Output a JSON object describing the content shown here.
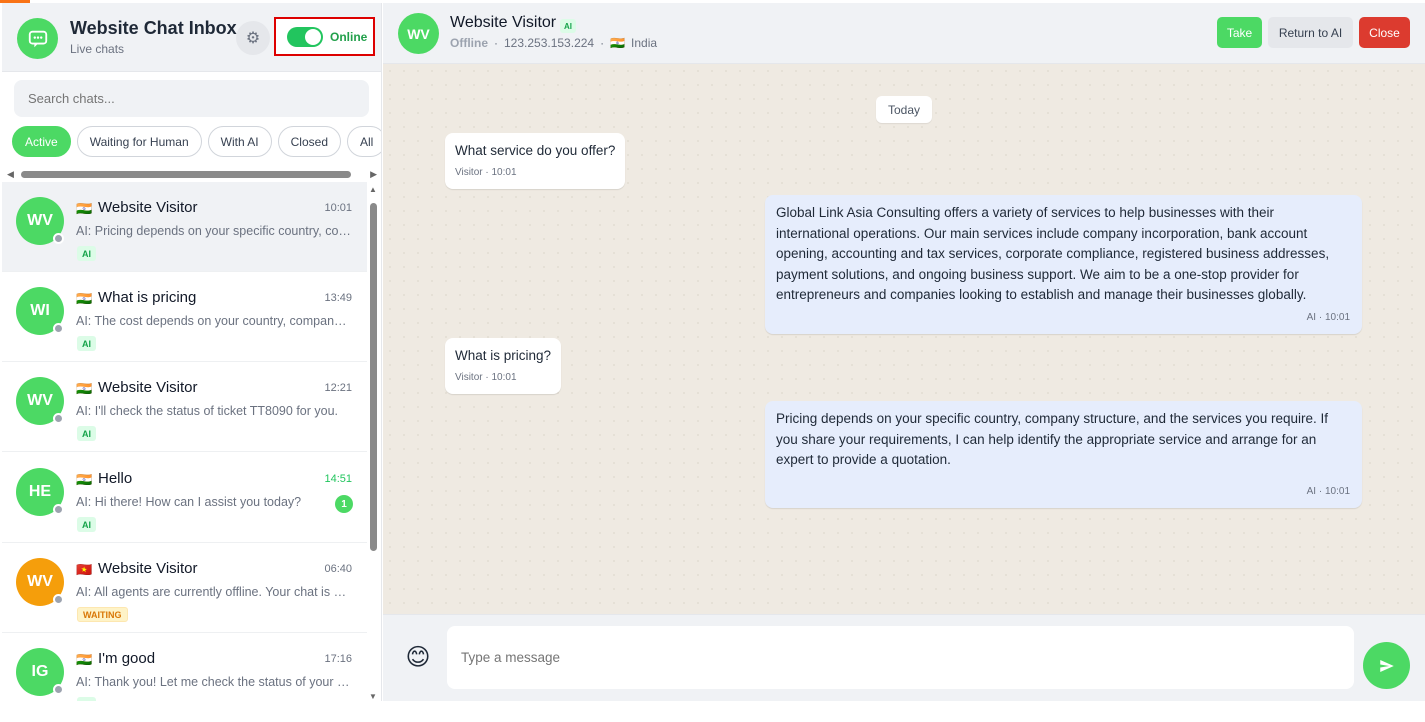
{
  "sidebar": {
    "title": "Website Chat Inbox",
    "subtitle": "Live chats",
    "online_label": "Online",
    "search_placeholder": "Search chats...",
    "filters": [
      "Active",
      "Waiting for Human",
      "With AI",
      "Closed",
      "All"
    ],
    "chats": [
      {
        "initials": "WV",
        "flag": "🇮🇳",
        "name": "Website Visitor",
        "time": "10:01",
        "preview": "AI: Pricing depends on your specific country, company structure, and the services you require.",
        "badge": "AI"
      },
      {
        "initials": "WI",
        "flag": "🇮🇳",
        "name": "What is pricing",
        "time": "13:49",
        "preview": "AI: The cost depends on your country, company structure and services.",
        "badge": "AI"
      },
      {
        "initials": "WV",
        "flag": "🇮🇳",
        "name": "Website Visitor",
        "time": "12:21",
        "preview": "AI: I'll check the status of ticket TT8090 for you.",
        "badge": "AI"
      },
      {
        "initials": "HE",
        "flag": "🇮🇳",
        "name": "Hello",
        "time": "14:51",
        "preview": "AI: Hi there! How can I assist you today?",
        "badge": "AI",
        "unread": "1"
      },
      {
        "initials": "WV",
        "flag": "🇻🇳",
        "name": "Website Visitor",
        "time": "06:40",
        "preview": "AI: All agents are currently offline. Your chat is queued.",
        "badge": "WAITING"
      },
      {
        "initials": "IG",
        "flag": "🇮🇳",
        "name": "I'm good",
        "time": "17:16",
        "preview": "AI: Thank you! Let me check the status of your request.",
        "badge": "AI"
      }
    ]
  },
  "conversation": {
    "initials": "WV",
    "name": "Website Visitor",
    "ai_badge": "AI",
    "status": "Offline",
    "ip": "123.253.153.224",
    "flag": "🇮🇳",
    "country": "India",
    "take_label": "Take",
    "return_label": "Return to AI",
    "close_label": "Close",
    "date_divider": "Today",
    "messages": [
      {
        "text": "What service do you offer?",
        "meta": "Visitor · 10:01"
      },
      {
        "text": "Global Link Asia Consulting offers a variety of services to help businesses with their international operations. Our main services include company incorporation, bank account opening, accounting and tax services, corporate compliance, registered business addresses, payment solutions, and ongoing business support. We aim to be a one-stop provider for entrepreneurs and companies looking to establish and manage their businesses globally.",
        "meta": "AI · 10:01"
      },
      {
        "text": "What is pricing?",
        "meta": "Visitor · 10:01"
      },
      {
        "text": "Pricing depends on your specific country, company structure, and the services you require. If you share your requirements, I can help identify the appropriate service and arrange for an expert to provide a quotation.",
        "meta": "AI · 10:01"
      }
    ],
    "input_placeholder": "Type a message"
  },
  "icons": {
    "app": "chat-bubble-icon",
    "settings": "gear-icon",
    "emoji": "smiley-icon",
    "send": "send-arrow-icon"
  },
  "colors": {
    "accent_green": "#4cd964",
    "close_red": "#dc3b2f",
    "waiting_orange": "#f59e0b",
    "ai_bubble": "#e6edfc"
  }
}
